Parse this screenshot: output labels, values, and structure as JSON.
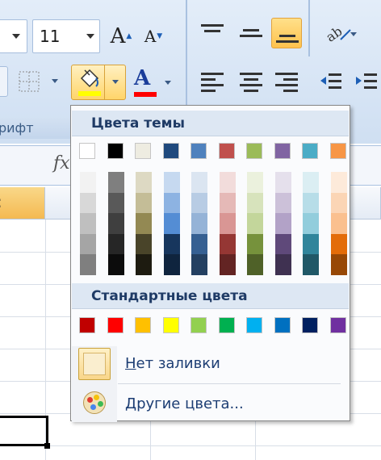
{
  "ribbon": {
    "font_size": "11",
    "group_label": "рифт",
    "grow_font_letter": "A",
    "shrink_font_letter": "A",
    "font_color_letter": "A",
    "fill_color": "#ffff00",
    "font_color": "#ff0000"
  },
  "formula_bar": {
    "fx_label": "fx"
  },
  "dropdown": {
    "theme_colors_title": "Цвета темы",
    "standard_colors_title": "Стандартные цвета",
    "no_fill_label": "Нет заливки",
    "more_colors_label": "Другие цвета...",
    "theme_base": [
      "#ffffff",
      "#000000",
      "#eeece1",
      "#1f497d",
      "#4f81bd",
      "#c0504d",
      "#9bbb59",
      "#8064a2",
      "#4bacc6",
      "#f79646"
    ],
    "theme_tints": [
      [
        "#f2f2f2",
        "#d8d8d8",
        "#bfbfbf",
        "#a5a5a5",
        "#7f7f7f"
      ],
      [
        "#7f7f7f",
        "#595959",
        "#3f3f3f",
        "#262626",
        "#0c0c0c"
      ],
      [
        "#ddd9c3",
        "#c4bd97",
        "#938953",
        "#494429",
        "#1d1b10"
      ],
      [
        "#c6d9f0",
        "#8db3e2",
        "#548dd4",
        "#17365d",
        "#0f243e"
      ],
      [
        "#dbe5f1",
        "#b8cce4",
        "#95b3d7",
        "#366092",
        "#244061"
      ],
      [
        "#f2dcdb",
        "#e5b9b7",
        "#d99694",
        "#953734",
        "#632423"
      ],
      [
        "#ebf1dd",
        "#d7e3bc",
        "#c3d69b",
        "#76923c",
        "#4f6128"
      ],
      [
        "#e5e0ec",
        "#ccc1d9",
        "#b2a2c7",
        "#5f497a",
        "#3f3151"
      ],
      [
        "#dbeef3",
        "#b7dde8",
        "#92cddc",
        "#31859b",
        "#205867"
      ],
      [
        "#fdeada",
        "#fbd5b5",
        "#fac08f",
        "#e36c09",
        "#974806"
      ]
    ],
    "standard": [
      "#c00000",
      "#ff0000",
      "#ffc000",
      "#ffff00",
      "#92d050",
      "#00b050",
      "#00b0f0",
      "#0070c0",
      "#002060",
      "#7030a0"
    ]
  }
}
